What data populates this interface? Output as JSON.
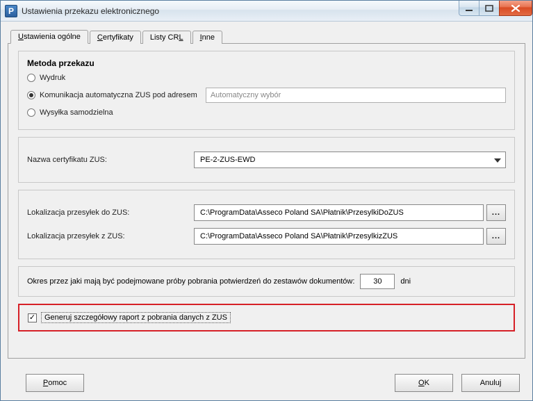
{
  "window": {
    "title": "Ustawienia przekazu elektronicznego"
  },
  "tabs": {
    "general": {
      "hotkey": "U",
      "rest": "stawienia ogólne"
    },
    "certs": {
      "hotkey": "C",
      "rest": "ertyfikaty"
    },
    "crl": {
      "pre": "Listy CR",
      "hotkey": "L",
      "rest": ""
    },
    "other": {
      "hotkey": "I",
      "rest": "nne"
    }
  },
  "method": {
    "title": "Metoda przekazu",
    "print": "Wydruk",
    "auto": "Komunikacja automatyczna ZUS pod adresem",
    "auto_placeholder": "Automatyczny wybór",
    "self": "Wysyłka samodzielna",
    "selected": "auto"
  },
  "cert": {
    "label": "Nazwa certyfikatu ZUS:",
    "value": "PE-2-ZUS-EWD"
  },
  "paths": {
    "to_label": "Lokalizacja przesyłek do ZUS:",
    "to_value": "C:\\ProgramData\\Asseco Poland SA\\Płatnik\\PrzesylkiDoZUS",
    "from_label": "Lokalizacja przesyłek z ZUS:",
    "from_value": "C:\\ProgramData\\Asseco Poland SA\\Płatnik\\PrzesylkizZUS",
    "browse": "..."
  },
  "retry": {
    "label": "Okres przez jaki mają być podejmowane próby pobrania potwierdzeń do zestawów dokumentów:",
    "value": "30",
    "unit": "dni"
  },
  "report": {
    "label": "Generuj szczegółowy raport z pobrania danych z ZUS",
    "checked": true
  },
  "buttons": {
    "help": {
      "hotkey": "P",
      "rest": "omoc"
    },
    "ok": {
      "hotkey": "O",
      "rest": "K"
    },
    "cancel": {
      "pre": "Anulu",
      "hotkey": "j",
      "rest": ""
    }
  }
}
